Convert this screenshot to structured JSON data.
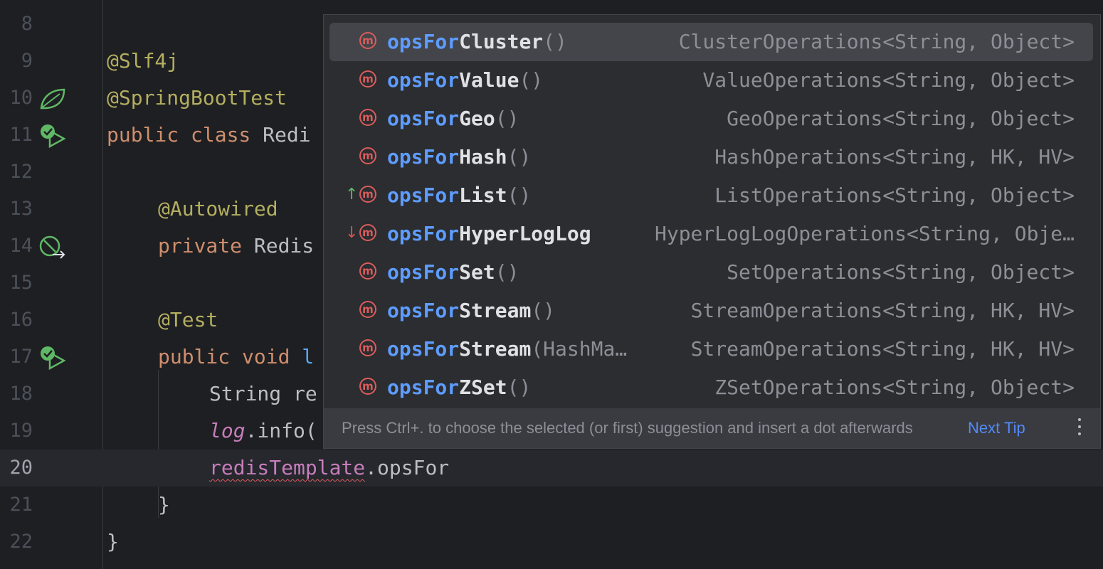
{
  "editor": {
    "lines": [
      {
        "num": "8"
      },
      {
        "num": "9",
        "ann": "@Slf4j"
      },
      {
        "num": "10",
        "ann": "@SpringBootTest"
      },
      {
        "num": "11",
        "kw": "public class ",
        "text": "Redi"
      },
      {
        "num": "12"
      },
      {
        "num": "13",
        "ann": "@Autowired"
      },
      {
        "num": "14",
        "kw": "private ",
        "text": "Redis"
      },
      {
        "num": "15"
      },
      {
        "num": "16",
        "ann": "@Test"
      },
      {
        "num": "17",
        "kw": "public void ",
        "text": "l"
      },
      {
        "num": "18",
        "text": "String re"
      },
      {
        "num": "19",
        "log": "log",
        "text": ".info("
      },
      {
        "num": "20",
        "field": "redisTemplate",
        "text": ".opsFor"
      },
      {
        "num": "21",
        "text": "}"
      },
      {
        "num": "22",
        "text": "}"
      }
    ]
  },
  "completion": {
    "prefix": "opsFor",
    "method_icon": "m",
    "items": [
      {
        "rest": "Cluster",
        "params": "()",
        "type": "ClusterOperations<String, Object>"
      },
      {
        "rest": "Value",
        "params": "()",
        "type": "ValueOperations<String, Object>"
      },
      {
        "rest": "Geo",
        "params": "()",
        "type": "GeoOperations<String, Object>"
      },
      {
        "rest": "Hash",
        "params": "()",
        "type": "HashOperations<String, HK, HV>"
      },
      {
        "rest": "List",
        "params": "()",
        "type": "ListOperations<String, Object>",
        "arrow": "↑"
      },
      {
        "rest": "HyperLogLog",
        "params": "",
        "type": "HyperLogLogOperations<String, Obje…",
        "arrow": "↓"
      },
      {
        "rest": "Set",
        "params": "()",
        "type": "SetOperations<String, Object>"
      },
      {
        "rest": "Stream",
        "params": "()",
        "type": "StreamOperations<String, HK, HV>"
      },
      {
        "rest": "Stream",
        "params": "(HashMa…",
        "type": "StreamOperations<String, HK, HV>"
      },
      {
        "rest": "ZSet",
        "params": "()",
        "type": "ZSetOperations<String, Object>"
      }
    ],
    "tip": "Press Ctrl+. to choose the selected (or first) suggestion and insert a dot afterwards",
    "next_tip": "Next Tip"
  }
}
